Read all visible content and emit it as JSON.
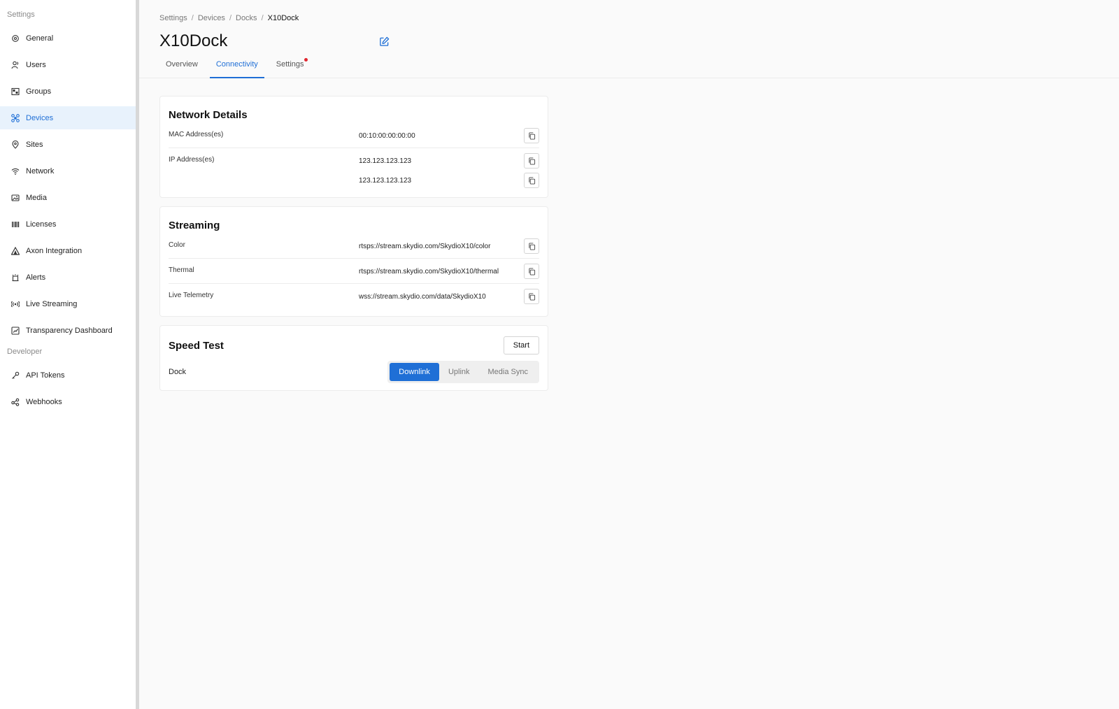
{
  "sidebar": {
    "settings_label": "Settings",
    "developer_label": "Developer",
    "items": [
      {
        "label": "General",
        "icon": "gear-icon"
      },
      {
        "label": "Users",
        "icon": "user-icon"
      },
      {
        "label": "Groups",
        "icon": "groups-icon"
      },
      {
        "label": "Devices",
        "icon": "drone-icon"
      },
      {
        "label": "Sites",
        "icon": "location-pin-icon"
      },
      {
        "label": "Network",
        "icon": "wifi-icon"
      },
      {
        "label": "Media",
        "icon": "image-icon"
      },
      {
        "label": "Licenses",
        "icon": "barcode-icon"
      },
      {
        "label": "Axon Integration",
        "icon": "axon-icon"
      },
      {
        "label": "Alerts",
        "icon": "alert-icon"
      },
      {
        "label": "Live Streaming",
        "icon": "broadcast-icon"
      },
      {
        "label": "Transparency Dashboard",
        "icon": "dashboard-icon"
      }
    ],
    "developer_items": [
      {
        "label": "API Tokens",
        "icon": "key-icon"
      },
      {
        "label": "Webhooks",
        "icon": "webhook-icon"
      }
    ],
    "active": "Devices"
  },
  "breadcrumb": [
    "Settings",
    "Devices",
    "Docks",
    "X10Dock"
  ],
  "page": {
    "title": "X10Dock",
    "tabs": [
      "Overview",
      "Connectivity",
      "Settings"
    ],
    "active_tab": "Connectivity"
  },
  "network": {
    "title": "Network Details",
    "mac_label": "MAC Address(es)",
    "mac_values": [
      "00:10:00:00:00:00"
    ],
    "ip_label": "IP Address(es)",
    "ip_values": [
      "123.123.123.123",
      "123.123.123.123"
    ]
  },
  "streaming": {
    "title": "Streaming",
    "rows": [
      {
        "label": "Color",
        "value": "rtsps://stream.skydio.com/SkydioX10/color"
      },
      {
        "label": "Thermal",
        "value": "rtsps://stream.skydio.com/SkydioX10/thermal"
      },
      {
        "label": "Live Telemetry",
        "value": "wss://stream.skydio.com/data/SkydioX10"
      }
    ]
  },
  "speed_test": {
    "title": "Speed Test",
    "start_label": "Start",
    "row_label": "Dock",
    "options": [
      "Downlink",
      "Uplink",
      "Media Sync"
    ],
    "active": "Downlink"
  },
  "colors": {
    "accent": "#1f6fd6",
    "active_bg": "#e8f2fc",
    "notification_dot": "#e0262f"
  }
}
